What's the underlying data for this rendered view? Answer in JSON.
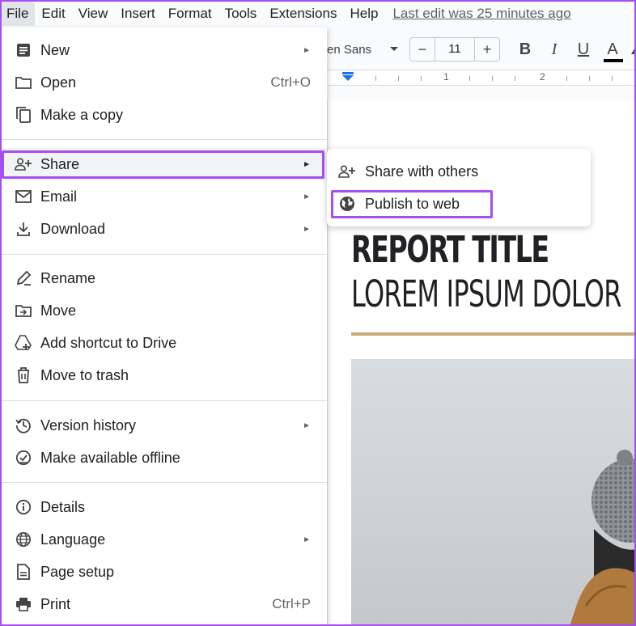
{
  "menubar": {
    "items": [
      "File",
      "Edit",
      "View",
      "Insert",
      "Format",
      "Tools",
      "Extensions",
      "Help"
    ],
    "last_edit": "Last edit was 25 minutes ago"
  },
  "toolbar": {
    "font": "en Sans",
    "font_size": "11",
    "minus": "−",
    "plus": "+",
    "bold": "B",
    "italic": "I",
    "underline": "U",
    "text_color": "A"
  },
  "ruler": {
    "marks": [
      "1",
      "2"
    ]
  },
  "file_menu": {
    "new": {
      "label": "New"
    },
    "open": {
      "label": "Open",
      "shortcut": "Ctrl+O"
    },
    "copy": {
      "label": "Make a copy"
    },
    "share": {
      "label": "Share"
    },
    "email": {
      "label": "Email"
    },
    "download": {
      "label": "Download"
    },
    "rename": {
      "label": "Rename"
    },
    "move": {
      "label": "Move"
    },
    "shortcut": {
      "label": "Add shortcut to Drive"
    },
    "trash": {
      "label": "Move to trash"
    },
    "version": {
      "label": "Version history"
    },
    "offline": {
      "label": "Make available offline"
    },
    "details": {
      "label": "Details"
    },
    "language": {
      "label": "Language"
    },
    "page_setup": {
      "label": "Page setup"
    },
    "print": {
      "label": "Print",
      "shortcut": "Ctrl+P"
    }
  },
  "share_submenu": {
    "share_with_others": "Share with others",
    "publish_to_web": "Publish to web"
  },
  "document": {
    "title": "REPORT TITLE",
    "subtitle": "LOREM IPSUM DOLOR"
  },
  "colors": {
    "highlight": "#a64ff0",
    "accent_line": "#c9aa7c",
    "ruler_marker": "#1a73e8"
  }
}
